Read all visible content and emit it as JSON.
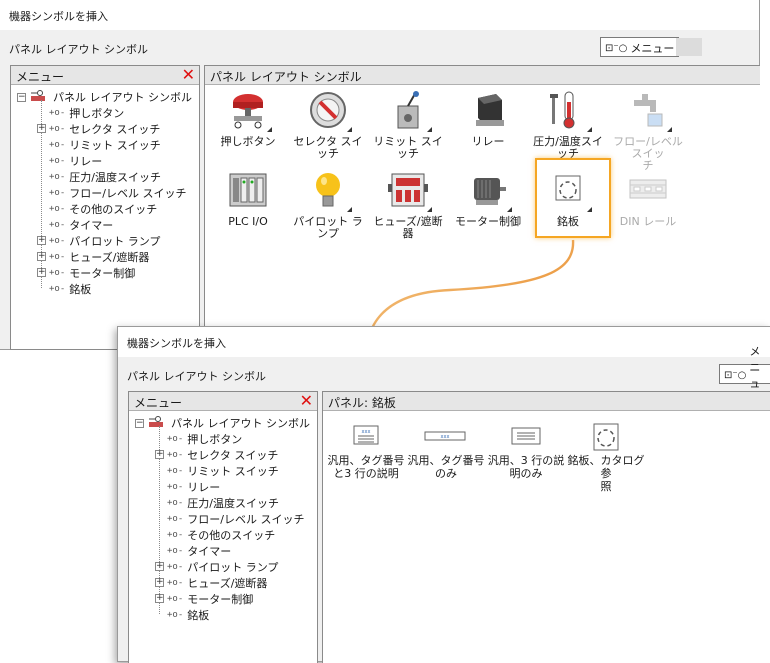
{
  "window_title": "機器シンボルを挿入",
  "breadcrumb": "パネル レイアウト シンボル",
  "menu_button_label": "メニュー",
  "menu_panel_title": "メニュー",
  "tree": {
    "root": "パネル レイアウト シンボル",
    "items": [
      {
        "label": "押しボタン",
        "expandable": false
      },
      {
        "label": "セレクタ スイッチ",
        "expandable": true
      },
      {
        "label": "リミット スイッチ",
        "expandable": false
      },
      {
        "label": "リレー",
        "expandable": false
      },
      {
        "label": "圧力/温度スイッチ",
        "expandable": false
      },
      {
        "label": "フロー/レベル スイッチ",
        "expandable": false
      },
      {
        "label": "その他のスイッチ",
        "expandable": false
      },
      {
        "label": "タイマー",
        "expandable": false
      },
      {
        "label": "パイロット ランプ",
        "expandable": true
      },
      {
        "label": "ヒューズ/遮断器",
        "expandable": true
      },
      {
        "label": "モーター制御",
        "expandable": true
      },
      {
        "label": "銘板",
        "expandable": false
      }
    ]
  },
  "main_panel_title": "パネル レイアウト シンボル",
  "grid": [
    {
      "label": "押しボタン",
      "icon": "pushbutton-icon"
    },
    {
      "label": "セレクタ スイッチ",
      "icon": "selector-switch-icon"
    },
    {
      "label": "リミット スイッチ",
      "icon": "limit-switch-icon"
    },
    {
      "label": "リレー",
      "icon": "relay-icon"
    },
    {
      "label": "圧力/温度スイッチ",
      "icon": "thermometer-icon"
    },
    {
      "label": "フロー/レベル スイッ\nチ",
      "icon": "faucet-icon"
    },
    {
      "label": "PLC I/O",
      "icon": "plc-icon"
    },
    {
      "label": "パイロット ランプ",
      "icon": "lightbulb-icon"
    },
    {
      "label": "ヒューズ/遮断器",
      "icon": "fuse-icon"
    },
    {
      "label": "モーター制御",
      "icon": "motor-icon"
    },
    {
      "label": "銘板",
      "icon": "nameplate-icon"
    },
    {
      "label": "DIN レール",
      "icon": "din-rail-icon"
    }
  ],
  "nameplate_panel_title": "パネル: 銘板",
  "nameplates": [
    {
      "label": "汎用、タグ番号\nと3 行の説明",
      "icon": "nameplate-tag-3line-icon"
    },
    {
      "label": "汎用、タグ番号\nのみ",
      "icon": "nameplate-tag-only-icon"
    },
    {
      "label": "汎用、3 行の説\n明のみ",
      "icon": "nameplate-3line-icon"
    },
    {
      "label": "銘板、カタログ参\n照",
      "icon": "nameplate-catalog-icon"
    }
  ],
  "colors": {
    "highlight": "#f5a623",
    "close": "#e01010",
    "lamp": "#f7c21a",
    "button_red": "#d33030"
  }
}
